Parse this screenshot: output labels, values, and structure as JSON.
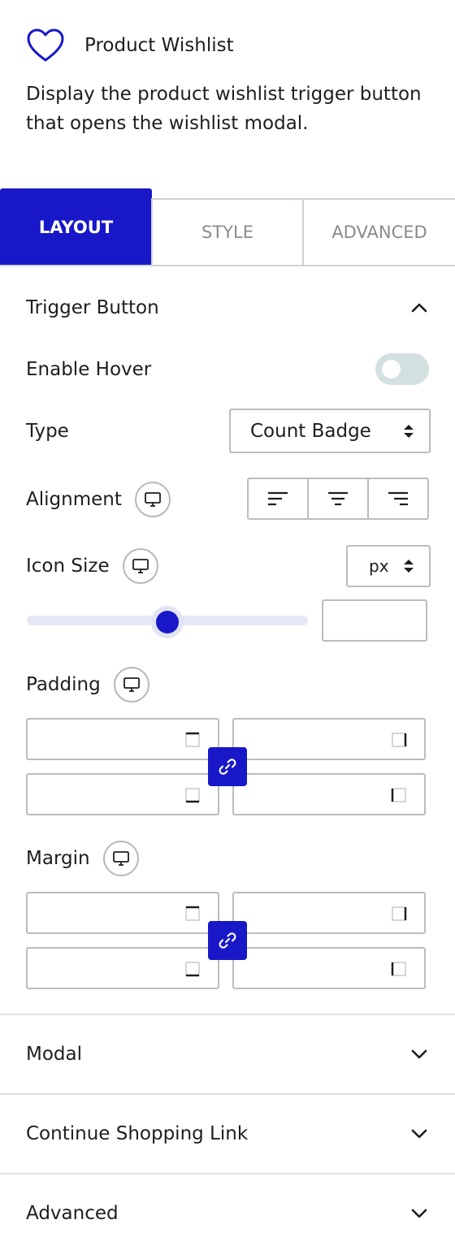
{
  "block": {
    "title": "Product Wishlist",
    "description": "Display the product wishlist trigger button that opens the wishlist modal.",
    "icon": "heart-icon"
  },
  "tabs": [
    {
      "label": "LAYOUT",
      "active": true
    },
    {
      "label": "STYLE",
      "active": false
    },
    {
      "label": "ADVANCED",
      "active": false
    }
  ],
  "trigger_section": {
    "title": "Trigger Button",
    "expanded": true,
    "enable_hover": {
      "label": "Enable Hover",
      "on": false
    },
    "type": {
      "label": "Type",
      "value": "Count Badge"
    },
    "alignment": {
      "label": "Alignment",
      "options": [
        "align-left-icon",
        "align-center-icon",
        "align-right-icon"
      ]
    },
    "icon_size": {
      "label": "Icon Size",
      "unit": "px",
      "value": "",
      "slider_fraction": 0.5
    },
    "padding": {
      "label": "Padding",
      "top": "",
      "right": "",
      "bottom": "",
      "left": ""
    },
    "margin": {
      "label": "Margin",
      "top": "",
      "right": "",
      "bottom": "",
      "left": ""
    }
  },
  "collapsed_sections": [
    {
      "title": "Modal"
    },
    {
      "title": "Continue Shopping Link"
    },
    {
      "title": "Advanced"
    }
  ],
  "colors": {
    "accent": "#1818c9",
    "toggle_off": "#d2e0e0",
    "border": "#bcbcbc"
  }
}
